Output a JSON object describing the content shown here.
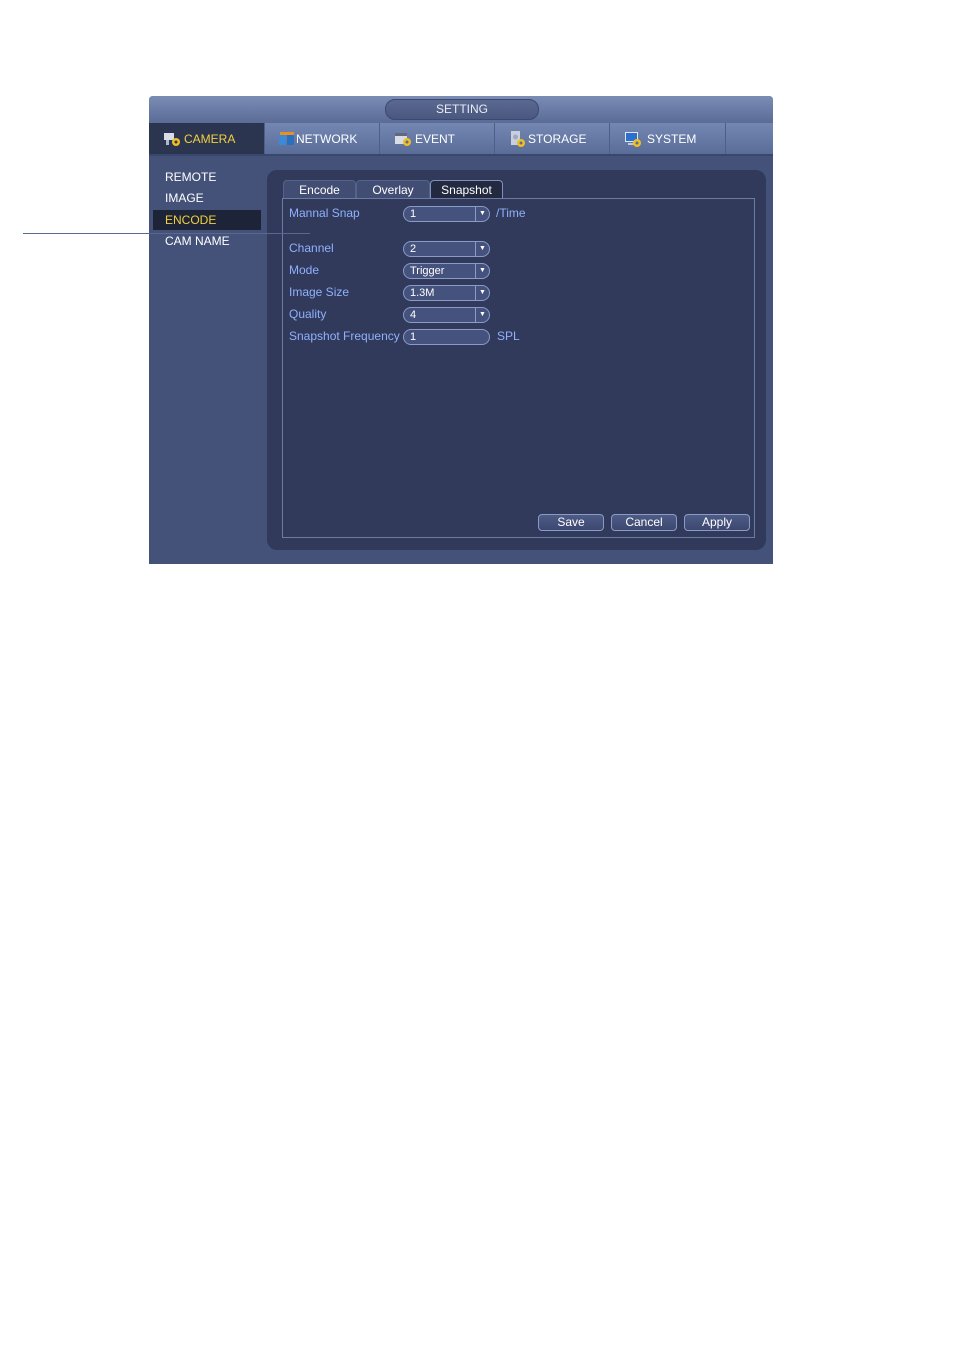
{
  "window": {
    "title": "SETTING"
  },
  "tabs": [
    {
      "label": "CAMERA",
      "icon": "camera-gear-icon",
      "active": true
    },
    {
      "label": "NETWORK",
      "icon": "network-icon",
      "active": false
    },
    {
      "label": "EVENT",
      "icon": "event-gear-icon",
      "active": false
    },
    {
      "label": "STORAGE",
      "icon": "storage-gear-icon",
      "active": false
    },
    {
      "label": "SYSTEM",
      "icon": "system-monitor-gear-icon",
      "active": false
    }
  ],
  "sidebar": {
    "items": [
      {
        "label": "REMOTE",
        "active": false
      },
      {
        "label": "IMAGE",
        "active": false
      },
      {
        "label": "ENCODE",
        "active": true
      },
      {
        "label": "CAM NAME",
        "active": false
      }
    ]
  },
  "subtabs": [
    {
      "label": "Encode",
      "active": false
    },
    {
      "label": "Overlay",
      "active": false
    },
    {
      "label": "Snapshot",
      "active": true
    }
  ],
  "form": {
    "manual_snap": {
      "label": "Mannal Snap",
      "value": "1",
      "suffix": "/Time"
    },
    "channel": {
      "label": "Channel",
      "value": "2"
    },
    "mode": {
      "label": "Mode",
      "value": "Trigger"
    },
    "image_size": {
      "label": "Image Size",
      "value": "1.3M"
    },
    "quality": {
      "label": "Quality",
      "value": "4"
    },
    "snapshot_frequency": {
      "label": "Snapshot Frequency",
      "value": "1",
      "suffix": "SPL"
    }
  },
  "buttons": {
    "save": "Save",
    "cancel": "Cancel",
    "apply": "Apply"
  },
  "colors": {
    "active_text": "#f0d040",
    "label_text": "#8fb0ff",
    "background": "#44527a",
    "panel": "#313a5a"
  }
}
